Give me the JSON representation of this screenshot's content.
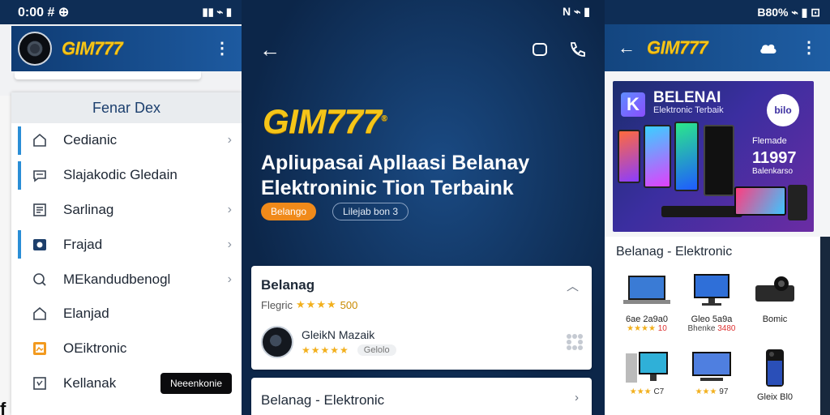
{
  "panel_left": {
    "status_time": "0:00 # ⊕",
    "brand": "GIM777",
    "drawer_header": "Fenar Dex",
    "items": [
      {
        "label": "Cedianic",
        "active": true,
        "icon": "home-icon"
      },
      {
        "label": "Slajakodic Gledain",
        "active": true,
        "icon": "chat-icon"
      },
      {
        "label": "Sarlinag",
        "active": false,
        "icon": "list-icon"
      },
      {
        "label": "Frajad",
        "active": true,
        "icon": "image-icon"
      },
      {
        "label": "MEkandudbenogl",
        "active": false,
        "icon": "search-icon"
      },
      {
        "label": "Elanjad",
        "active": false,
        "icon": "home-icon"
      },
      {
        "label": "OEiktronic",
        "active": false,
        "icon": "image-icon"
      },
      {
        "label": "Kellanak",
        "active": false,
        "icon": "doc-icon",
        "pill": "Neeenkonie"
      }
    ],
    "edge_text": "f"
  },
  "panel_center": {
    "status": "N ⌁ ▮",
    "brand": "GIM777",
    "brand_mark": "®",
    "title": "Apliupasai Apllaasi Belanay Elektroninic Tion Terbaink",
    "cta_primary": "Belango",
    "cta_secondary": "Lilejab bon 3",
    "card1": {
      "title": "Belanag",
      "rating_label": "Flegric",
      "rating_stars": "★★★★",
      "rating_value": "500",
      "product_name": "GleikN  Mazaik",
      "product_stars": "★★★★★",
      "product_badge": "Gelolo"
    },
    "card2": {
      "title": "Belanag - Elektronic"
    }
  },
  "panel_right": {
    "status": "B80% ⌁ ▮ ⊡",
    "brand": "GIM777",
    "banner": {
      "k": "K",
      "title": "BELENAI",
      "subtitle": "Elektronic Terbaik",
      "badge": "bilo",
      "side_label": "Flemade",
      "side_value": "11997",
      "side_foot": "Balenkarso"
    },
    "section_title": "Belanag - Elektronic",
    "products": [
      {
        "name": "6ae 2a9a0",
        "stars": "★★★★",
        "price": "10"
      },
      {
        "name": "Gleo 5a9a",
        "stars": "Bhenke",
        "price": "3480"
      },
      {
        "name": "Bomic",
        "stars": "",
        "price": ""
      },
      {
        "name": "",
        "stars": "★★★",
        "price": "C7"
      },
      {
        "name": "",
        "stars": "★★★",
        "price": "97"
      },
      {
        "name": "Gleix Bl0",
        "stars": "",
        "price": ""
      }
    ]
  }
}
